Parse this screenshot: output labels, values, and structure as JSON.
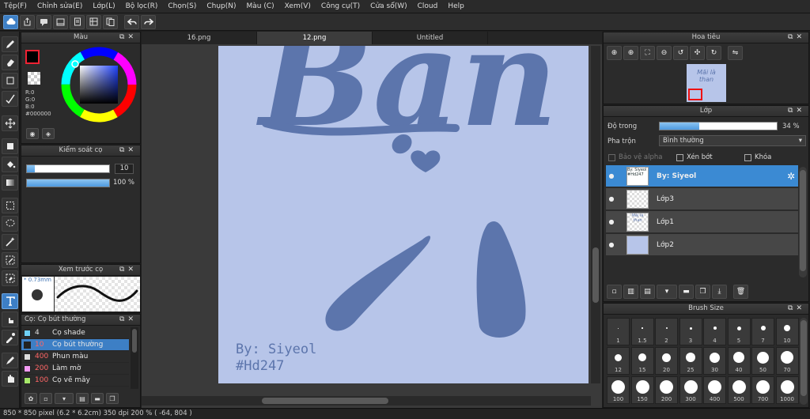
{
  "menu": [
    "Tệp(F)",
    "Chỉnh sửa(E)",
    "Lớp(L)",
    "Bộ lọc(R)",
    "Chọn(S)",
    "Chụp(N)",
    "Màu (C)",
    "Xem(V)",
    "Công cụ(T)",
    "Cửa sổ(W)",
    "Cloud",
    "Help"
  ],
  "colors": {
    "accent": "#3d7fc5",
    "canvas_bg": "#b7c5e9",
    "ink": "#5c75ac",
    "panel": "#2b2b2b"
  },
  "color_panel": {
    "title": "Màu",
    "r": "R:0",
    "g": "G:0",
    "b": "B:0",
    "hex": "#000000"
  },
  "brush_control": {
    "title": "Kiểm soát cọ",
    "size_value": "10",
    "opacity_value": "100 %",
    "size_fraction": 0.1,
    "opacity_fraction": 1.0
  },
  "brush_preview": {
    "title": "Xem trước cọ",
    "size_label": "* 0.73mm"
  },
  "brush_list": {
    "title": "Cọ: Cọ bút thường",
    "items": [
      {
        "num": "4",
        "name": "Cọ shade",
        "color": "#6fd0f5"
      },
      {
        "num": "10",
        "name": "Cọ bút thường",
        "color": "#222222",
        "selected": true
      },
      {
        "num": "400",
        "name": "Phun màu",
        "color": "#dddddd"
      },
      {
        "num": "200",
        "name": "Làm mờ",
        "color": "#f29af2"
      },
      {
        "num": "100",
        "name": "Cọ vẽ mây",
        "color": "#a6e86a"
      }
    ]
  },
  "tabs": [
    {
      "label": "16.png"
    },
    {
      "label": "12.png",
      "active": true
    },
    {
      "label": "Untitled"
    }
  ],
  "canvas": {
    "letters": "Bạn",
    "sig1": "By: Siyeol",
    "sig2": "#Hd247"
  },
  "navigator": {
    "title": "Hoa tiêu",
    "thumb_line1": "Mãi là",
    "thumb_line2": "than"
  },
  "layer_panel": {
    "title": "Lớp",
    "opacity_label": "Độ trong",
    "opacity_value": "34 %",
    "opacity_fraction": 0.34,
    "blend_label": "Pha trộn",
    "blend_value": "Bình thường",
    "protect_alpha": "Bảo vệ alpha",
    "clip": "Xén bớt",
    "lock": "Khóa",
    "layers": [
      {
        "name": "By: Siyeol",
        "selected": true,
        "thumb_text": "By: Siyeol #Hd247"
      },
      {
        "name": "Lớp3"
      },
      {
        "name": "Lớp1",
        "thumb_text": "Mãi là than"
      },
      {
        "name": "Lớp2",
        "fill": "#b7c5e9"
      }
    ]
  },
  "brush_size": {
    "title": "Brush Size",
    "sizes": [
      [
        "1",
        "1.5",
        "2",
        "3",
        "4",
        "5",
        "7",
        "10"
      ],
      [
        "12",
        "15",
        "20",
        "25",
        "30",
        "40",
        "50",
        "70"
      ],
      [
        "100",
        "150",
        "200",
        "300",
        "400",
        "500",
        "700",
        "1000"
      ]
    ]
  },
  "status": "850 * 850 pixel  (6.2 * 6.2cm)  350 dpi  200 %  ( -64, 804 )"
}
